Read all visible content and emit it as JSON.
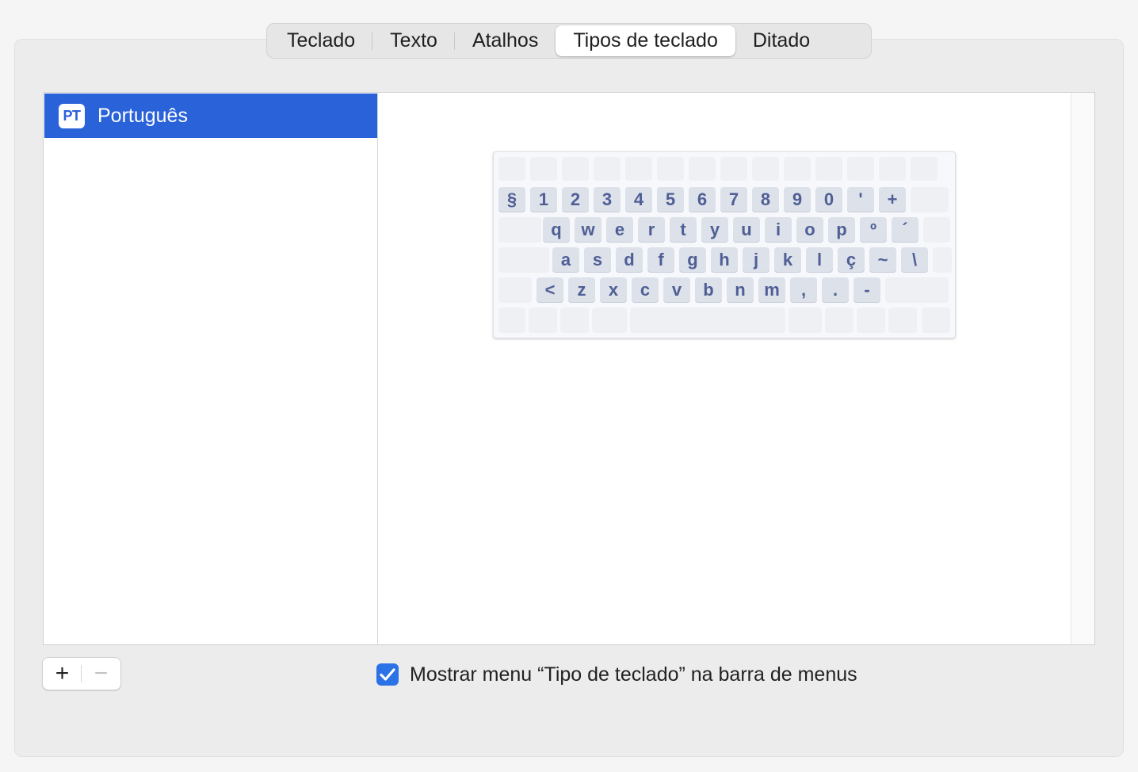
{
  "tabs": [
    {
      "label": "Teclado",
      "active": false
    },
    {
      "label": "Texto",
      "active": false
    },
    {
      "label": "Atalhos",
      "active": false
    },
    {
      "label": "Tipos de teclado",
      "active": true
    },
    {
      "label": "Ditado",
      "active": false
    }
  ],
  "input_sources": [
    {
      "badge": "PT",
      "label": "Português",
      "selected": true
    }
  ],
  "keyboard_rows": {
    "numbers": [
      "§",
      "1",
      "2",
      "3",
      "4",
      "5",
      "6",
      "7",
      "8",
      "9",
      "0",
      "'",
      "+"
    ],
    "top": [
      "q",
      "w",
      "e",
      "r",
      "t",
      "y",
      "u",
      "i",
      "o",
      "p",
      "º",
      "´"
    ],
    "home": [
      "a",
      "s",
      "d",
      "f",
      "g",
      "h",
      "j",
      "k",
      "l",
      "ç",
      "~",
      "\\"
    ],
    "bottom": [
      "<",
      "z",
      "x",
      "c",
      "v",
      "b",
      "n",
      "m",
      ",",
      ".",
      "-"
    ]
  },
  "buttons": {
    "add": "+",
    "remove": "−"
  },
  "show_menu": {
    "checked": true,
    "label": "Mostrar menu “Tipo de teclado” na barra de menus"
  },
  "colors": {
    "selection": "#2a62d9",
    "checkbox": "#2a72e6",
    "key_text": "#4f5f95"
  },
  "icons": {
    "checkmark": "checkmark-icon",
    "badge": "language-badge-icon"
  }
}
